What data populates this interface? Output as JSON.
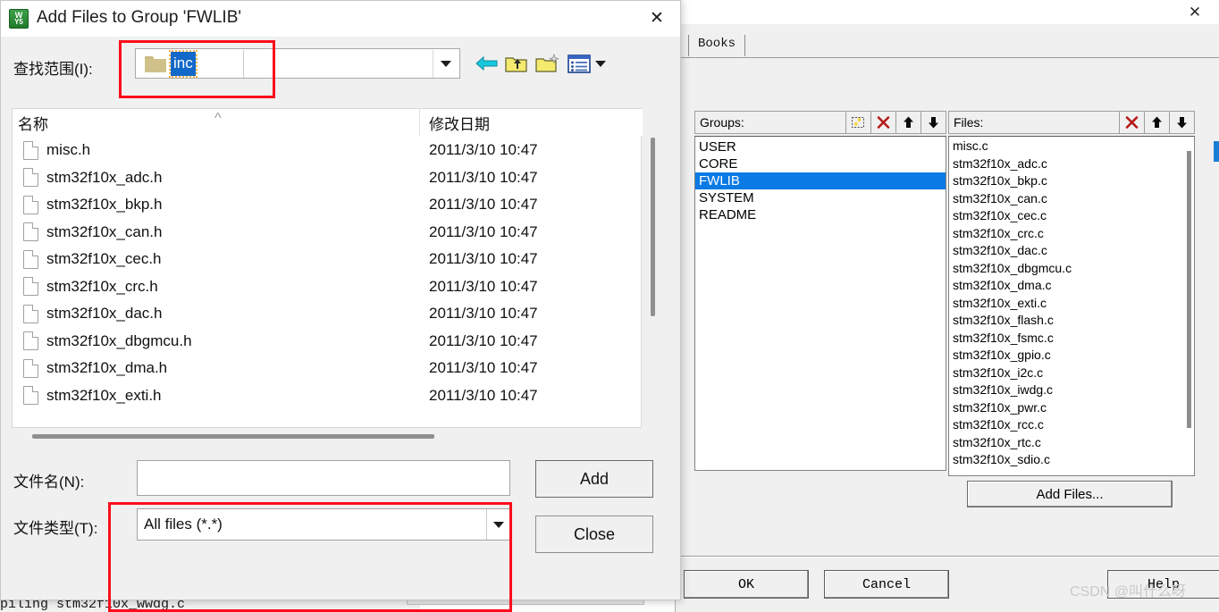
{
  "keil_window": {
    "close_icon": "✕",
    "tab_label": "Books",
    "groups": {
      "header_label": "Groups:",
      "toolbar": [
        {
          "name": "new-group-icon",
          "glyph": "▤"
        },
        {
          "name": "delete-group-icon",
          "glyph": "✕"
        },
        {
          "name": "move-up-icon",
          "glyph": "⬆"
        },
        {
          "name": "move-down-icon",
          "glyph": "⬇"
        }
      ],
      "items": [
        "USER",
        "CORE",
        "FWLIB",
        "SYSTEM",
        "README"
      ],
      "selected": "FWLIB",
      "selected_index": 2
    },
    "files": {
      "header_label": "Files:",
      "toolbar": [
        {
          "name": "delete-file-icon",
          "glyph": "✕"
        },
        {
          "name": "move-up-icon",
          "glyph": "⬆"
        },
        {
          "name": "move-down-icon",
          "glyph": "⬇"
        }
      ],
      "items": [
        "misc.c",
        "stm32f10x_adc.c",
        "stm32f10x_bkp.c",
        "stm32f10x_can.c",
        "stm32f10x_cec.c",
        "stm32f10x_crc.c",
        "stm32f10x_dac.c",
        "stm32f10x_dbgmcu.c",
        "stm32f10x_dma.c",
        "stm32f10x_exti.c",
        "stm32f10x_flash.c",
        "stm32f10x_fsmc.c",
        "stm32f10x_gpio.c",
        "stm32f10x_i2c.c",
        "stm32f10x_iwdg.c",
        "stm32f10x_pwr.c",
        "stm32f10x_rcc.c",
        "stm32f10x_rtc.c",
        "stm32f10x_sdio.c"
      ]
    },
    "add_files_label": "Add Files...",
    "ok_label": "OK",
    "cancel_label": "Cancel",
    "help_label": "Help",
    "watermark": "CSDN @叫什么呀"
  },
  "status": {
    "text": "piling stm32f10x_wwdg.c"
  },
  "dialog": {
    "title": "Add Files to Group 'FWLIB'",
    "app_icon_line1": "W",
    "app_icon_line2": "Y5",
    "close_icon": "✕",
    "lookin": {
      "label": "查找范围(I):",
      "value": "inc",
      "folder_icon": "folder-icon",
      "dropdown_icon": "chevron-down-icon"
    },
    "toolbar": [
      {
        "name": "back-arrow-icon",
        "glyph": "⬅"
      },
      {
        "name": "up-one-level-icon",
        "glyph": "⬆"
      },
      {
        "name": "new-folder-icon",
        "glyph": "✶"
      },
      {
        "name": "view-mode-icon",
        "glyph": "▦"
      },
      {
        "name": "view-mode-dropdown-icon",
        "glyph": "▾"
      }
    ],
    "browser": {
      "col_name": "名称",
      "col_date": "修改日期",
      "sort_caret": "^",
      "rows": [
        {
          "name": "misc.h",
          "date": "2011/3/10 10:47"
        },
        {
          "name": "stm32f10x_adc.h",
          "date": "2011/3/10 10:47"
        },
        {
          "name": "stm32f10x_bkp.h",
          "date": "2011/3/10 10:47"
        },
        {
          "name": "stm32f10x_can.h",
          "date": "2011/3/10 10:47"
        },
        {
          "name": "stm32f10x_cec.h",
          "date": "2011/3/10 10:47"
        },
        {
          "name": "stm32f10x_crc.h",
          "date": "2011/3/10 10:47"
        },
        {
          "name": "stm32f10x_dac.h",
          "date": "2011/3/10 10:47"
        },
        {
          "name": "stm32f10x_dbgmcu.h",
          "date": "2011/3/10 10:47"
        },
        {
          "name": "stm32f10x_dma.h",
          "date": "2011/3/10 10:47"
        },
        {
          "name": "stm32f10x_exti.h",
          "date": "2011/3/10 10:47"
        }
      ]
    },
    "filename": {
      "label": "文件名(N):",
      "value": "",
      "placeholder": ""
    },
    "filetype": {
      "label": "文件类型(T):",
      "value": "All files (*.*)",
      "dropdown_icon": "chevron-down-icon"
    },
    "add_label": "Add",
    "close_label": "Close"
  },
  "colors": {
    "selection_blue": "#0a7ae4",
    "annotation_red": "#fc0d1b",
    "chrome_gray": "#f0f0f0"
  }
}
